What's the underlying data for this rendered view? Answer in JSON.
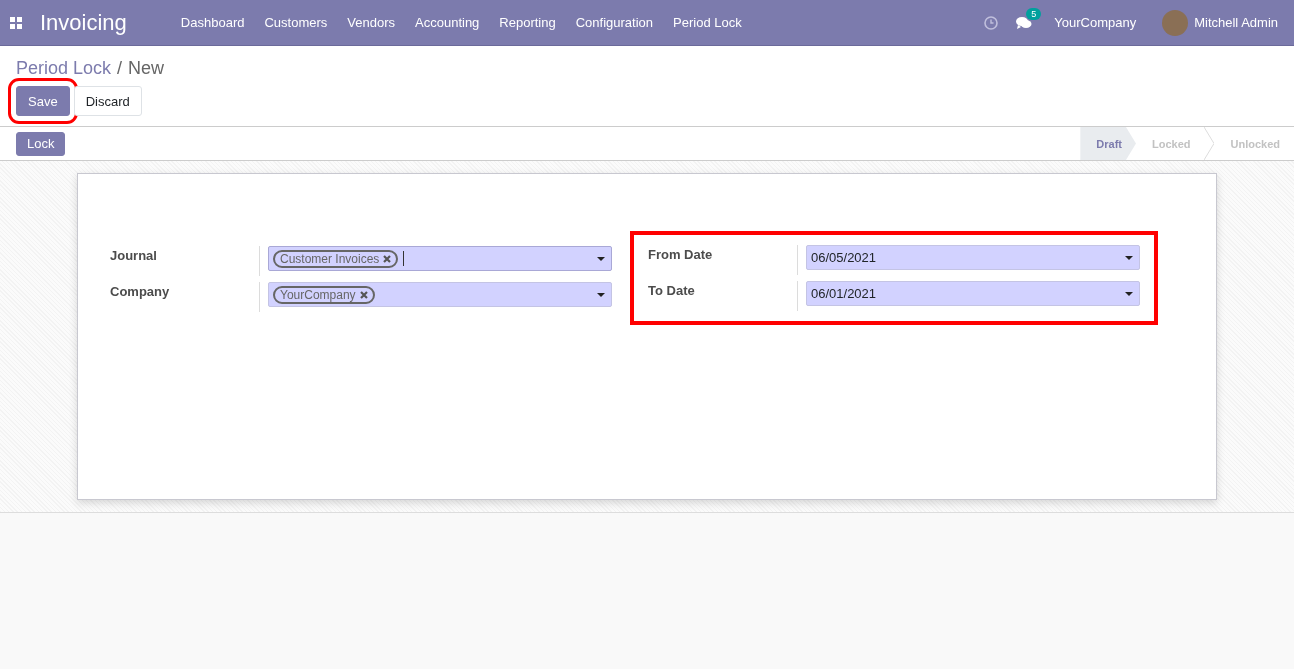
{
  "navbar": {
    "app_title": "Invoicing",
    "menu": [
      "Dashboard",
      "Customers",
      "Vendors",
      "Accounting",
      "Reporting",
      "Configuration",
      "Period Lock"
    ],
    "message_count": "5",
    "company": "YourCompany",
    "user": "Mitchell Admin"
  },
  "breadcrumb": {
    "parent": "Period Lock",
    "separator": "/",
    "current": "New"
  },
  "buttons": [
    {
      "label": "Save",
      "kind": "primary",
      "highlighted": true
    },
    {
      "label": "Discard",
      "kind": "secondary",
      "highlighted": false
    }
  ],
  "action_buttons": [
    "Lock"
  ],
  "status_stages": [
    {
      "label": "Draft",
      "selected": true
    },
    {
      "label": "Locked",
      "selected": false
    },
    {
      "label": "Unlocked",
      "selected": false
    }
  ],
  "left_fields": [
    {
      "label": "Journal",
      "tags": [
        "Customer Invoices"
      ],
      "focused": true
    },
    {
      "label": "Company",
      "tags": [
        "YourCompany"
      ],
      "focused": false
    }
  ],
  "right_group": {
    "highlighted": true,
    "fields": [
      {
        "label": "From Date",
        "value": "06/05/2021"
      },
      {
        "label": "To Date",
        "value": "06/01/2021"
      }
    ]
  }
}
